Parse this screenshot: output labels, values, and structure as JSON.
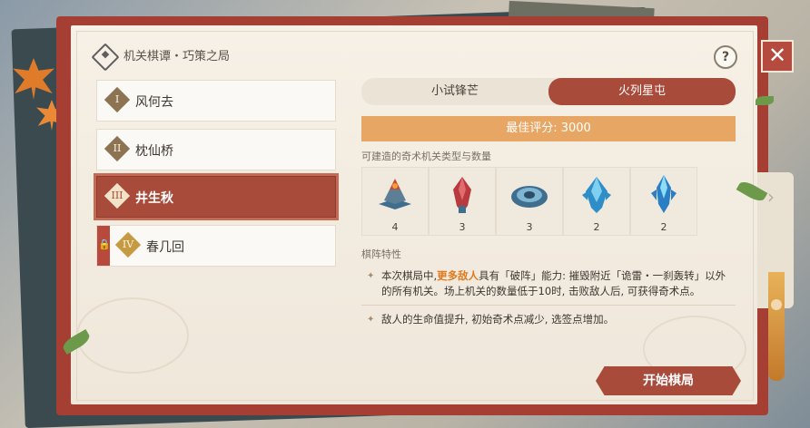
{
  "header": {
    "title": "机关棋谭・巧策之局",
    "help_label": "?",
    "close_label": "✕"
  },
  "levels": [
    {
      "numeral": "I",
      "label": "风何去",
      "state": "normal"
    },
    {
      "numeral": "II",
      "label": "枕仙桥",
      "state": "normal"
    },
    {
      "numeral": "III",
      "label": "井生秋",
      "state": "selected"
    },
    {
      "numeral": "IV",
      "label": "春几回",
      "state": "locked"
    }
  ],
  "tabs": [
    {
      "label": "小试锋芒",
      "active": false
    },
    {
      "label": "火列星屯",
      "active": true
    }
  ],
  "best_score": "最佳评分: 3000",
  "units_label": "可建造的奇术机关类型与数量",
  "units": [
    {
      "icon": "volcano-tower-icon",
      "count": "4",
      "color": "#c84a32"
    },
    {
      "icon": "red-crystal-tower-icon",
      "count": "3",
      "color": "#b83a3e"
    },
    {
      "icon": "spiral-disc-icon",
      "count": "3",
      "color": "#3f6e8e"
    },
    {
      "icon": "blue-crystal-icon",
      "count": "2",
      "color": "#2f8ec8"
    },
    {
      "icon": "blue-spire-icon",
      "count": "2",
      "color": "#2a7fc4"
    }
  ],
  "features_label": "棋阵特性",
  "feature1": {
    "pre": "本次棋局中,",
    "highlight": "更多敌人",
    "post": "具有「破阵」能力: 摧毁附近「诡雷・一刹轰转」以外的所有机关。场上机关的数量低于10时, 击败敌人后, 可获得奇术点。"
  },
  "feature2": "敌人的生命值提升, 初始奇术点减少, 选签点增加。",
  "start_button": "开始棋局",
  "colors": {
    "accent": "#a84b3b",
    "score": "#e8a664",
    "highlight": "#e07b1f"
  }
}
